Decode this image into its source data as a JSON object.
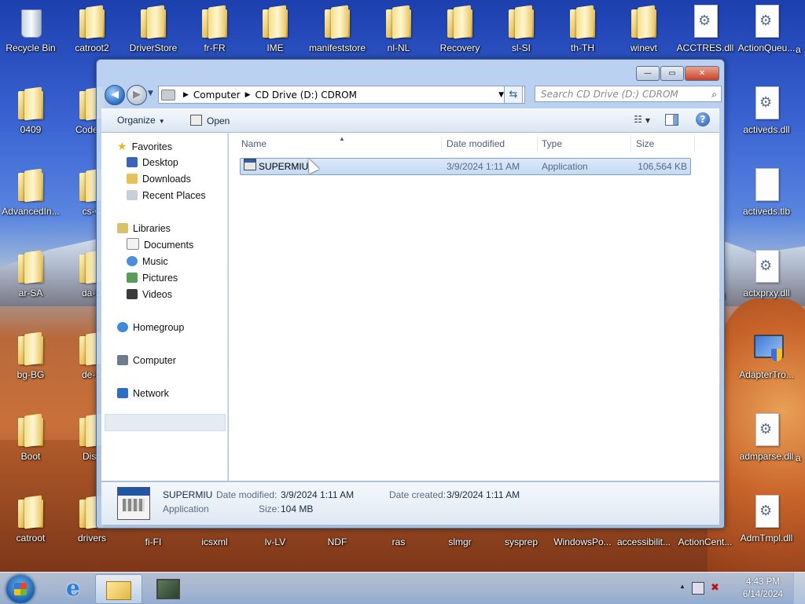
{
  "desktop": {
    "icons": [
      {
        "label": "Recycle Bin",
        "type": "bin"
      },
      {
        "label": "catroot2",
        "type": "folder"
      },
      {
        "label": "DriverStore",
        "type": "folder"
      },
      {
        "label": "fr-FR",
        "type": "folder"
      },
      {
        "label": "IME",
        "type": "folder"
      },
      {
        "label": "manifeststore",
        "type": "folder"
      },
      {
        "label": "nl-NL",
        "type": "folder"
      },
      {
        "label": "Recovery",
        "type": "folder"
      },
      {
        "label": "sl-SI",
        "type": "folder"
      },
      {
        "label": "th-TH",
        "type": "folder"
      },
      {
        "label": "winevt",
        "type": "folder"
      },
      {
        "label": "ACCTRES.dll",
        "type": "dll"
      },
      {
        "label": "ActionQueu...",
        "type": "dll"
      },
      {
        "label": "0409",
        "type": "folder"
      },
      {
        "label": "CodeInt",
        "type": "folder"
      },
      {
        "label": "activeds.dll",
        "type": "dll"
      },
      {
        "label": "AdvancedIn...",
        "type": "folder"
      },
      {
        "label": "cs-C",
        "type": "folder"
      },
      {
        "label": "activeds.tlb",
        "type": "tlb"
      },
      {
        "label": "ar-SA",
        "type": "folder"
      },
      {
        "label": "da-D",
        "type": "folder"
      },
      {
        "label": "actxprxy.dll",
        "type": "dll"
      },
      {
        "label": "bg-BG",
        "type": "folder"
      },
      {
        "label": "de-D",
        "type": "folder"
      },
      {
        "label": "AdapterTro...",
        "type": "monitor"
      },
      {
        "label": "Boot",
        "type": "folder"
      },
      {
        "label": "Disp",
        "type": "folder"
      },
      {
        "label": "admparse.dll",
        "type": "dll"
      },
      {
        "label": "catroot",
        "type": "folder"
      },
      {
        "label": "drivers",
        "type": "folder"
      },
      {
        "label": "fi-FI",
        "type": "label"
      },
      {
        "label": "icsxml",
        "type": "label"
      },
      {
        "label": "lv-LV",
        "type": "label"
      },
      {
        "label": "NDF",
        "type": "label"
      },
      {
        "label": "ras",
        "type": "label"
      },
      {
        "label": "slmgr",
        "type": "label"
      },
      {
        "label": "sysprep",
        "type": "label"
      },
      {
        "label": "WindowsPo...",
        "type": "label"
      },
      {
        "label": "accessibilit...",
        "type": "label"
      },
      {
        "label": "ActionCent...",
        "type": "label"
      },
      {
        "label": "AdmTmpl.dll",
        "type": "dll"
      },
      {
        "label": "a",
        "type": "label"
      },
      {
        "label": "a",
        "type": "label"
      },
      {
        "label": "dll",
        "type": "label"
      }
    ]
  },
  "window": {
    "caption_buttons": {
      "minimize": "—",
      "maximize": "▭",
      "close": "✕"
    },
    "address": {
      "root": "Computer",
      "current": "CD Drive (D:) CDROM"
    },
    "search": {
      "placeholder": "Search CD Drive (D:) CDROM"
    },
    "commands": {
      "organize": "Organize",
      "open": "Open",
      "help": "?"
    },
    "nav": {
      "favorites": "Favorites",
      "desktop": "Desktop",
      "downloads": "Downloads",
      "recent_places": "Recent Places",
      "libraries": "Libraries",
      "documents": "Documents",
      "music": "Music",
      "pictures": "Pictures",
      "videos": "Videos",
      "homegroup": "Homegroup",
      "computer": "Computer",
      "network": "Network"
    },
    "columns": {
      "name": "Name",
      "date_modified": "Date modified",
      "type": "Type",
      "size": "Size"
    },
    "files": [
      {
        "name": "SUPERMIU",
        "date_modified": "3/9/2024 1:11 AM",
        "type": "Application",
        "size": "106,564 KB"
      }
    ],
    "details": {
      "name": "SUPERMIU",
      "type": "Application",
      "date_modified_label": "Date modified:",
      "date_modified": "3/9/2024 1:11 AM",
      "size_label": "Size:",
      "size": "104 MB",
      "date_created_label": "Date created:",
      "date_created": "3/9/2024 1:11 AM"
    }
  },
  "taskbar": {
    "clock_time": "4:43 PM",
    "clock_date": "6/14/2024"
  }
}
